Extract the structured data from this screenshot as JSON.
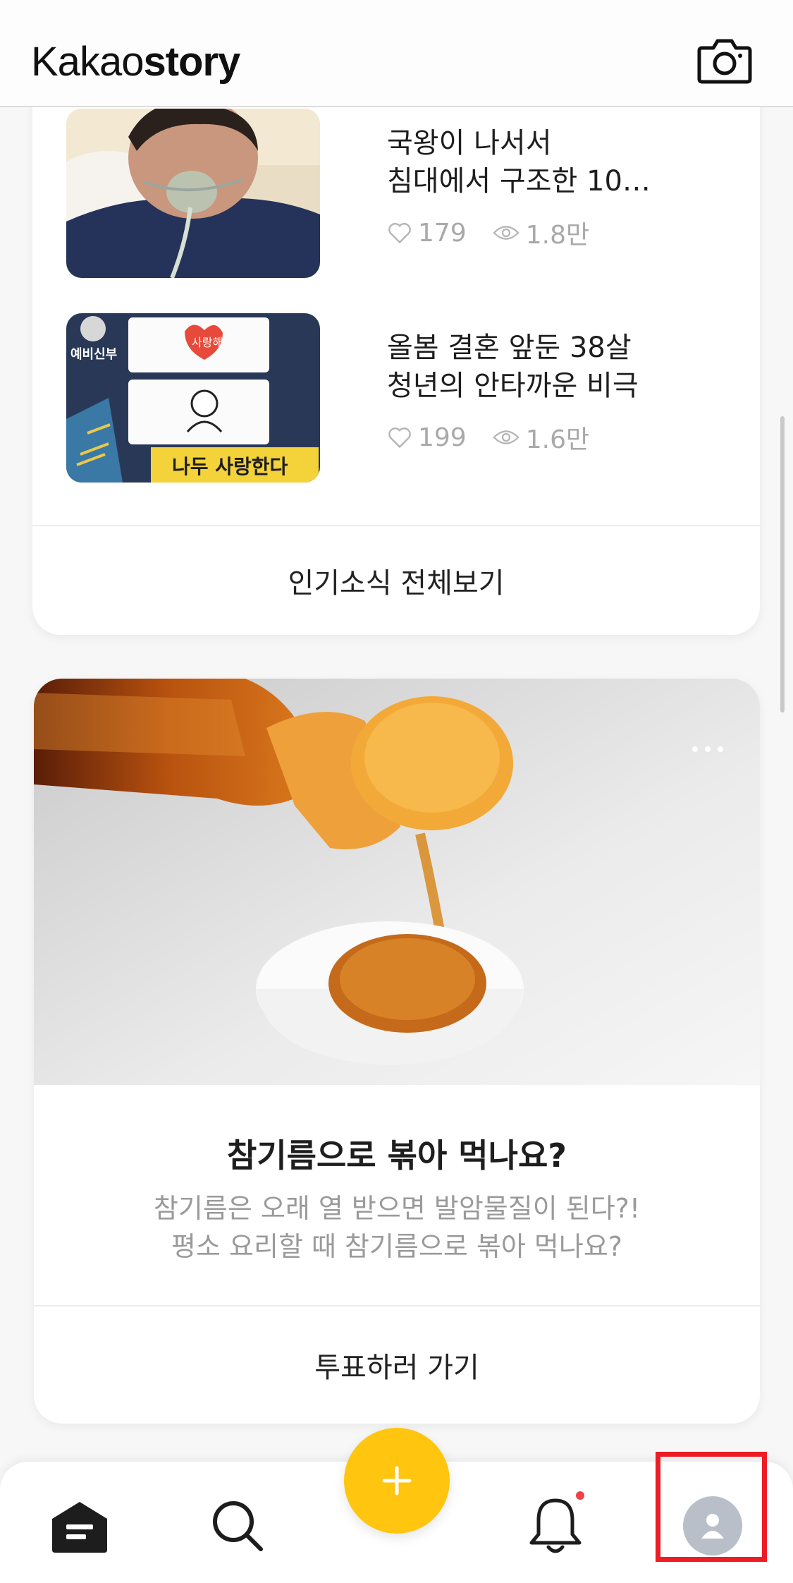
{
  "header": {
    "logo_regular": "Kakao",
    "logo_bold": "story",
    "camera_icon": "camera-icon"
  },
  "popular_news": {
    "items": [
      {
        "title_line1": "국왕이 나서서",
        "title_line2": "침대에서 구조한 10…",
        "likes": "179",
        "views": "1.8만",
        "thumb_icon": "news-thumbnail-oxygen-mask"
      },
      {
        "title_line1": "올봄 결혼 앞둔 38살",
        "title_line2": "청년의 안타까운 비극",
        "likes": "199",
        "views": "1.6만",
        "thumb_icon": "news-thumbnail-comic",
        "thumb_caption": "나두 사랑한다",
        "thumb_label": "예비신부",
        "thumb_heart": "사랑해"
      }
    ],
    "view_all_label": "인기소식 전체보기"
  },
  "poll": {
    "title": "참기름으로 볶아 먹나요?",
    "desc_line1": "참기름은 오래 열 받으면 발암물질이 된다?!",
    "desc_line2": "평소 요리할 때 참기름으로 볶아 먹나요?",
    "action_label": "투표하러 가기",
    "image_icon": "sesame-oil-pouring-photo"
  },
  "bottom_nav": {
    "items": [
      "home-icon",
      "search-icon",
      "add-icon",
      "bell-icon",
      "profile-icon"
    ],
    "has_notification": true
  },
  "colors": {
    "accent": "#ffc50f",
    "highlight": "#ee1c24",
    "notification": "#f0404a"
  }
}
